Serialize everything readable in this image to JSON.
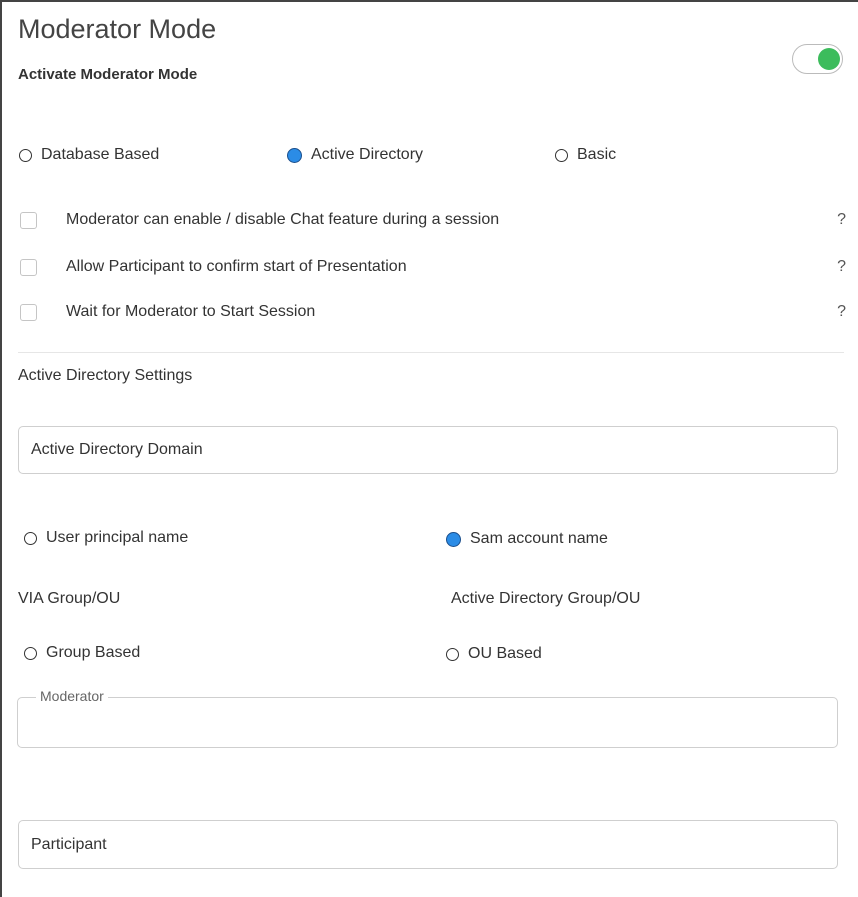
{
  "header": {
    "title": "Moderator Mode",
    "activate_label": "Activate Moderator Mode",
    "activate_on": true
  },
  "auth_types": [
    {
      "label": "Database Based",
      "selected": false
    },
    {
      "label": "Active Directory",
      "selected": true
    },
    {
      "label": "Basic",
      "selected": false
    }
  ],
  "options": [
    {
      "label": "Moderator can enable / disable Chat feature during a session",
      "checked": false,
      "help": "?"
    },
    {
      "label": "Allow Participant to confirm start of Presentation",
      "checked": false,
      "help": "?"
    },
    {
      "label": "Wait for Moderator to Start Session",
      "checked": false,
      "help": "?"
    }
  ],
  "ad_settings": {
    "section_title": "Active Directory Settings",
    "domain_placeholder": "Active Directory Domain",
    "name_types": [
      {
        "label": "User principal name",
        "selected": false
      },
      {
        "label": "Sam account name",
        "selected": true
      }
    ],
    "via_label": "VIA Group/OU",
    "ad_group_label": "Active Directory Group/OU",
    "group_types": [
      {
        "label": "Group Based",
        "selected": false
      },
      {
        "label": "OU Based",
        "selected": false
      }
    ],
    "moderator_legend": "Moderator",
    "moderator_value": "",
    "participant_placeholder": "Participant"
  },
  "colors": {
    "toggle_on": "#3cbc5c",
    "radio_selected": "#2b8ce6"
  }
}
